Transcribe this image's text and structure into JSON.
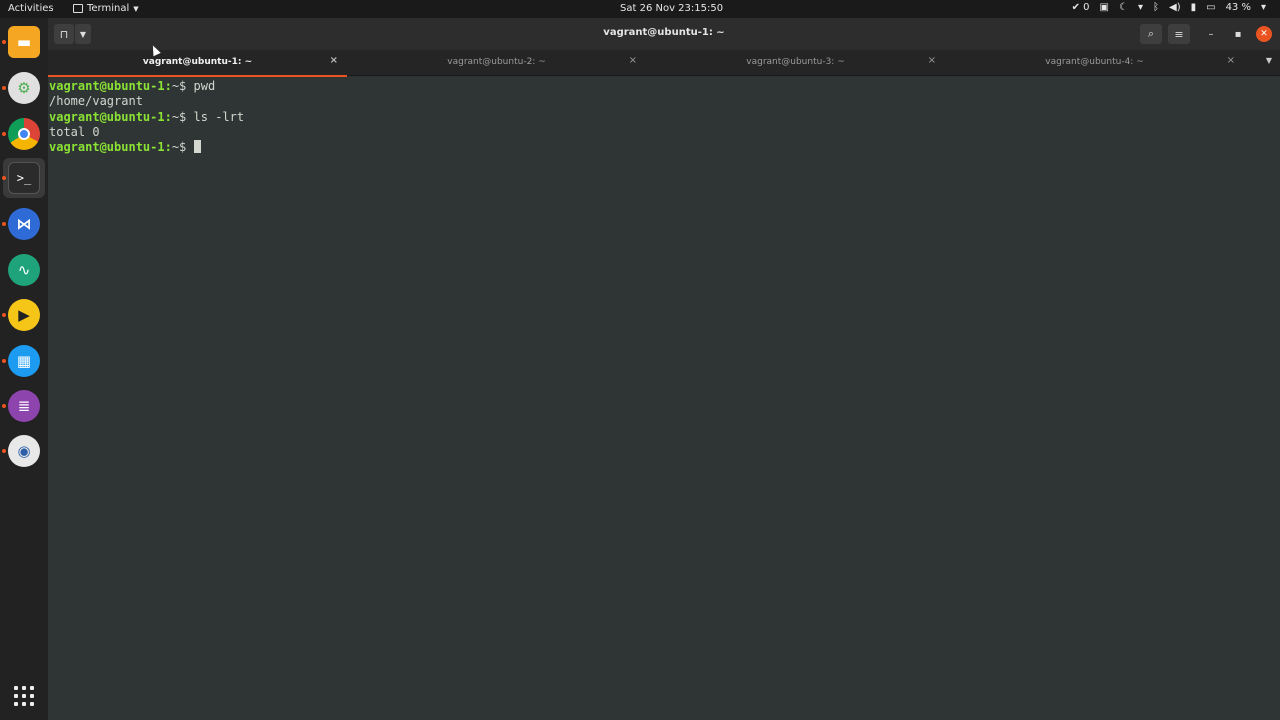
{
  "topbar": {
    "activities": "Activities",
    "app_name": "Terminal",
    "clock": "Sat 26 Nov  23:15:50",
    "notifications_count": "0",
    "battery": "43 %"
  },
  "dock": {
    "items": [
      {
        "name": "files",
        "color": "#f5a623"
      },
      {
        "name": "settings",
        "color": "#4caf50"
      },
      {
        "name": "chrome",
        "color": "#db4437"
      },
      {
        "name": "terminal",
        "color": "#333333"
      },
      {
        "name": "vscode",
        "color": "#2f6bd6"
      },
      {
        "name": "system-monitor",
        "color": "#1fa37a"
      },
      {
        "name": "media-player",
        "color": "#f5c518"
      },
      {
        "name": "app-blue",
        "color": "#1d9bf0"
      },
      {
        "name": "text-editor",
        "color": "#8e44ad"
      },
      {
        "name": "screenshot",
        "color": "#2c5fa8"
      }
    ]
  },
  "window": {
    "title": "vagrant@ubuntu-1: ~",
    "tabs": [
      {
        "label": "vagrant@ubuntu-1: ~",
        "active": true
      },
      {
        "label": "vagrant@ubuntu-2: ~",
        "active": false
      },
      {
        "label": "vagrant@ubuntu-3: ~",
        "active": false
      },
      {
        "label": "vagrant@ubuntu-4: ~",
        "active": false
      }
    ]
  },
  "terminal": {
    "prompt": "vagrant@ubuntu-1:",
    "lines": [
      {
        "path": "~$ ",
        "command": "pwd"
      },
      {
        "output": "/home/vagrant"
      },
      {
        "path": "~$ ",
        "command": "ls -lrt"
      },
      {
        "output": "total 0"
      },
      {
        "path": "~$ ",
        "command": ""
      }
    ]
  },
  "colors": {
    "accent": "#e95420",
    "prompt": "#8ae234",
    "text": "#d3d7cf"
  }
}
